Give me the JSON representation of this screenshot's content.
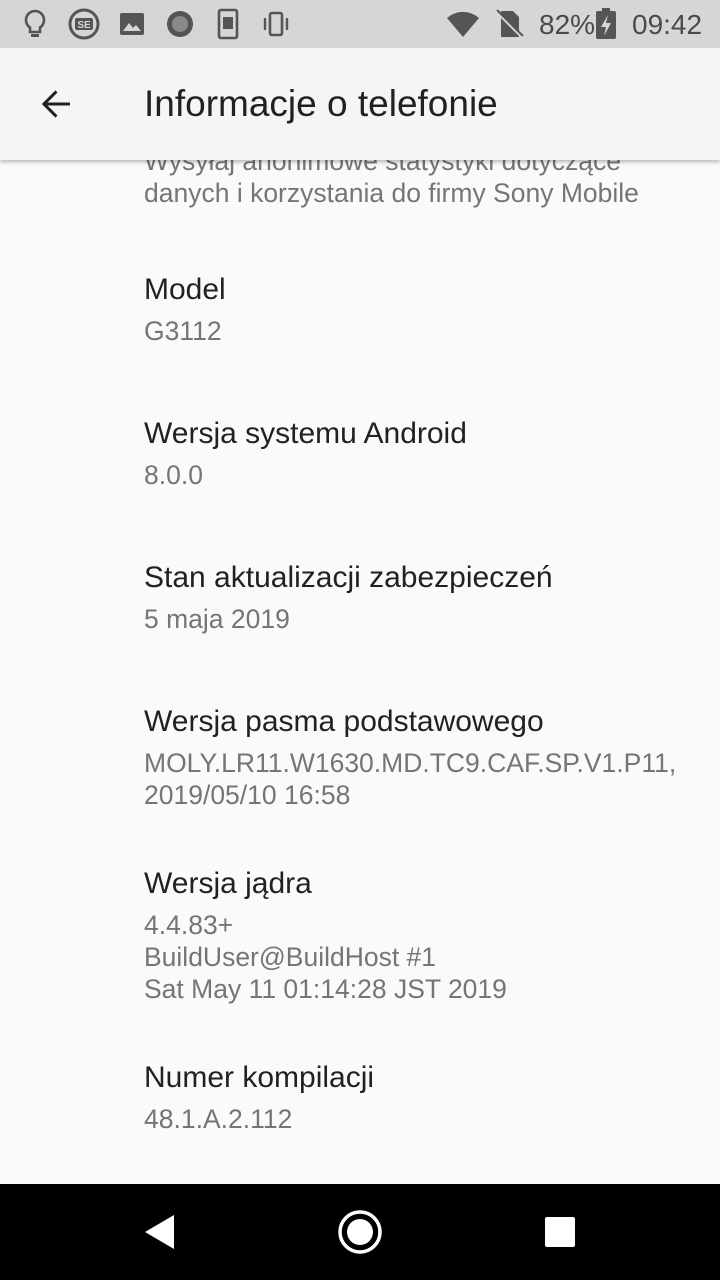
{
  "status_bar": {
    "left_icons": [
      "lightbulb-icon",
      "se-app-icon",
      "image-icon",
      "circle-record-icon",
      "phone-file-icon",
      "phone-vibrate-icon"
    ],
    "right_icons": [
      "wifi-icon",
      "no-sim-icon",
      "battery-charging-icon"
    ],
    "battery_percent": "82%",
    "time": "09:42"
  },
  "app_bar": {
    "back_icon": "arrow-back-icon",
    "title": "Informacje o telefonie"
  },
  "items": [
    {
      "title": "",
      "summary": "Wysyłaj anonimowe statystyki dotyczące\ndanych i korzystania do firmy Sony Mobile"
    },
    {
      "title": "Model",
      "summary": "G3112"
    },
    {
      "title": "Wersja systemu Android",
      "summary": "8.0.0"
    },
    {
      "title": "Stan aktualizacji zabezpieczeń",
      "summary": "5 maja 2019"
    },
    {
      "title": "Wersja pasma podstawowego",
      "summary": "MOLY.LR11.W1630.MD.TC9.CAF.SP.V1.P11,\n2019/05/10 16:58"
    },
    {
      "title": "Wersja jądra",
      "summary": "4.4.83+\nBuildUser@BuildHost #1\nSat May 11 01:14:28 JST 2019"
    },
    {
      "title": "Numer kompilacji",
      "summary": "48.1.A.2.112"
    }
  ],
  "nav_bar": {
    "buttons": [
      "back-triangle-icon",
      "home-circle-icon",
      "recents-square-icon"
    ]
  },
  "colors": {
    "status_bar_bg": "#d6d6d6",
    "app_bar_bg": "#f5f5f5",
    "content_bg": "#fafafa",
    "title_text": "#212121",
    "summary_text": "#757575",
    "nav_bar_bg": "#000000"
  }
}
